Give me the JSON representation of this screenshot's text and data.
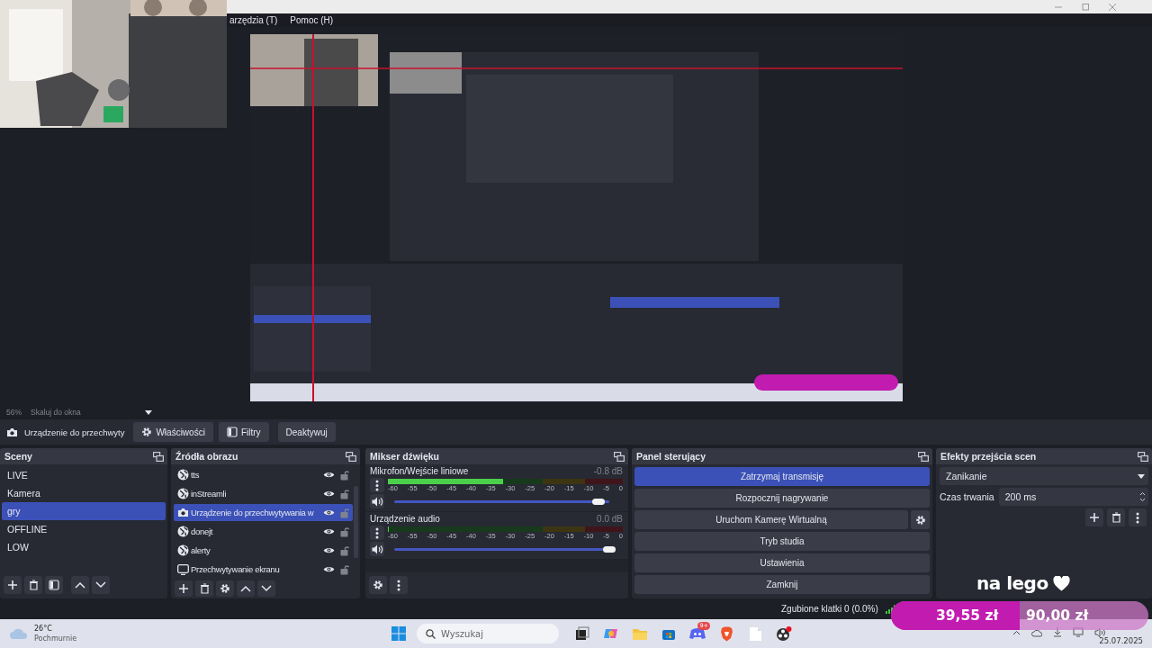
{
  "menu": [
    {
      "label": "arzędzia (T)"
    },
    {
      "label": "Pomoc (H)"
    }
  ],
  "zoom": {
    "percent": "56%",
    "mode": "Skaluj do okna"
  },
  "source_toolbar": {
    "source": "Urządzenie do przechwyty",
    "buttons": [
      {
        "label": "Właściwości",
        "kind": "properties"
      },
      {
        "label": "Filtry",
        "kind": "filters"
      },
      {
        "label": "Deaktywuj",
        "kind": "plain"
      }
    ]
  },
  "scenes": {
    "title": "Sceny",
    "items": [
      {
        "label": "LIVE",
        "selected": false
      },
      {
        "label": "Kamera",
        "selected": false
      },
      {
        "label": "gry",
        "selected": true
      },
      {
        "label": "OFFLINE",
        "selected": false
      },
      {
        "label": "LOW",
        "selected": false
      }
    ]
  },
  "sources": {
    "title": "Źródła obrazu",
    "items": [
      {
        "label": "tts",
        "kind": "browser",
        "selected": false,
        "visible": true,
        "locked": false
      },
      {
        "label": "inStreamli",
        "kind": "browser",
        "selected": false,
        "visible": true,
        "locked": false
      },
      {
        "label": "Urządzenie do przechwytywania w",
        "kind": "camera",
        "selected": true,
        "visible": true,
        "locked": false
      },
      {
        "label": "donejt",
        "kind": "browser",
        "selected": false,
        "visible": true,
        "locked": false
      },
      {
        "label": "alerty",
        "kind": "browser",
        "selected": false,
        "visible": true,
        "locked": false
      },
      {
        "label": "Przechwytywanie ekranu",
        "kind": "display",
        "selected": false,
        "visible": true,
        "locked": false
      }
    ]
  },
  "mixer": {
    "title": "Mikser dźwięku",
    "channels": [
      {
        "name": "Mikrofon/Wejście liniowe",
        "reading": "-0.8 dB",
        "meter": {
          "level": 0.49
        },
        "volume": {
          "level": 0.95
        },
        "scale": [
          "-60",
          "-55",
          "-50",
          "-45",
          "-40",
          "-35",
          "-30",
          "-25",
          "-20",
          "-15",
          "-10",
          "-5",
          "0"
        ]
      },
      {
        "name": "Urządzenie audio",
        "reading": "0.0 dB",
        "meter": {
          "level": 0
        },
        "volume": {
          "level": 1
        },
        "scale": [
          "-60",
          "-55",
          "-50",
          "-45",
          "-40",
          "-35",
          "-30",
          "-25",
          "-20",
          "-15",
          "-10",
          "-5",
          "0"
        ]
      }
    ]
  },
  "controls": {
    "title": "Panel sterujący",
    "buttons": [
      {
        "label": "Zatrzymaj transmisję",
        "active": true,
        "settings": false
      },
      {
        "label": "Rozpocznij nagrywanie",
        "active": false,
        "settings": false
      },
      {
        "label": "Uruchom Kamerę Wirtualną",
        "active": false,
        "settings": true
      },
      {
        "label": "Tryb studia",
        "active": false,
        "settings": false
      },
      {
        "label": "Ustawienia",
        "active": false,
        "settings": false
      },
      {
        "label": "Zamknij",
        "active": false,
        "settings": false
      }
    ]
  },
  "transitions": {
    "title": "Efekty przejścia scen",
    "effect": "Zanikanie",
    "duration_label": "Czas trwania",
    "duration": "200 ms"
  },
  "status_bar": {
    "dropped_frames": "Zgubione klatki 0 (0.0%)"
  },
  "overlay": {
    "caption": "na lego",
    "goal": {
      "raised": "39,55 zł",
      "target": "90,00 zł",
      "level": 0.5
    }
  },
  "taskbar": {
    "weather": {
      "temperature": "26°C",
      "condition": "Pochmurnie"
    },
    "search": {
      "placeholder": "Wyszukaj"
    },
    "apps": [
      {
        "kind": "taskview"
      },
      {
        "kind": "copilot"
      },
      {
        "kind": "folder"
      },
      {
        "kind": "store"
      },
      {
        "kind": "chat",
        "badge": "9+"
      },
      {
        "kind": "shield"
      },
      {
        "kind": "notes"
      },
      {
        "kind": "recorder"
      }
    ],
    "date": "25.07.2025"
  }
}
